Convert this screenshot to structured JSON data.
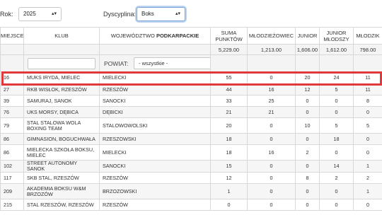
{
  "filters": {
    "year_label": "Rok:",
    "year_value": "2025",
    "discipline_label": "Dyscyplina:",
    "discipline_value": "Boks"
  },
  "table": {
    "headers": {
      "place": "Miejsce",
      "club": "Klub",
      "voivodeship_prefix": "Województwo",
      "voivodeship_name": "Podkarpackie",
      "points": "Suma punktów",
      "mlodziezowiec": "Młodzieżowiec",
      "junior": "Junior",
      "junior_mlodszy": "Junior młodszy",
      "mlodzik": "Młodzik"
    },
    "totals": {
      "points": "5,229.00",
      "mlodziezowiec": "1,213.00",
      "junior": "1,606.00",
      "junior_mlodszy": "1,612.00",
      "mlodzik": "798.00"
    },
    "filter_row": {
      "powiat_label": "POWIAT:",
      "powiat_value": "- wszystkie -",
      "clear_icon": "close-icon"
    },
    "rows": [
      {
        "place": "16",
        "club": "MUKS IRYDA, MIELEC",
        "powiat": "MIELECKI",
        "points": "55",
        "mlodziezowiec": "0",
        "junior": "20",
        "junior_mlodszy": "24",
        "mlodzik": "11"
      },
      {
        "place": "27",
        "club": "RKB WISŁOK, RZESZÓW",
        "powiat": "RZESZÓW",
        "points": "44",
        "mlodziezowiec": "16",
        "junior": "12",
        "junior_mlodszy": "5",
        "mlodzik": "11"
      },
      {
        "place": "39",
        "club": "SAMURAJ, SANOK",
        "powiat": "SANOCKI",
        "points": "33",
        "mlodziezowiec": "25",
        "junior": "0",
        "junior_mlodszy": "0",
        "mlodzik": "8"
      },
      {
        "place": "76",
        "club": "UKS MORSY, DĘBICA",
        "powiat": "DĘBICKI",
        "points": "21",
        "mlodziezowiec": "21",
        "junior": "0",
        "junior_mlodszy": "0",
        "mlodzik": "0"
      },
      {
        "place": "79",
        "club": "STAL STALOWA WOLA BOXING TEAM",
        "powiat": "STALOWOWOLSKI",
        "points": "20",
        "mlodziezowiec": "0",
        "junior": "10",
        "junior_mlodszy": "5",
        "mlodzik": "5"
      },
      {
        "place": "86",
        "club": "GIMNASION, BOGUCHWAŁA",
        "powiat": "RZESZOWSKI",
        "points": "18",
        "mlodziezowiec": "0",
        "junior": "0",
        "junior_mlodszy": "18",
        "mlodzik": "0"
      },
      {
        "place": "86",
        "club": "MIELECKA SZKOŁA BOKSU, MIELEC",
        "powiat": "MIELECKI",
        "points": "18",
        "mlodziezowiec": "16",
        "junior": "2",
        "junior_mlodszy": "0",
        "mlodzik": "0"
      },
      {
        "place": "102",
        "club": "STREET AUTONOMY SANOK",
        "powiat": "SANOCKI",
        "points": "15",
        "mlodziezowiec": "0",
        "junior": "0",
        "junior_mlodszy": "14",
        "mlodzik": "1"
      },
      {
        "place": "117",
        "club": "SKB STAL, RZESZÓW",
        "powiat": "RZESZÓW",
        "points": "12",
        "mlodziezowiec": "0",
        "junior": "8",
        "junior_mlodszy": "2",
        "mlodzik": "2"
      },
      {
        "place": "209",
        "club": "AKADEMIA BOKSU W&M BRZOZÓW",
        "powiat": "BRZOZOWSKI",
        "points": "1",
        "mlodziezowiec": "0",
        "junior": "0",
        "junior_mlodszy": "0",
        "mlodzik": "1"
      },
      {
        "place": "215",
        "club": "STAL RZESZÓW, RZESZÓW",
        "powiat": "RZESZÓW",
        "points": "0",
        "mlodziezowiec": "0",
        "junior": "0",
        "junior_mlodszy": "0",
        "mlodzik": "0"
      }
    ]
  },
  "colors": {
    "highlight": "#e0393c",
    "focus_ring": "#bcd4ef"
  }
}
